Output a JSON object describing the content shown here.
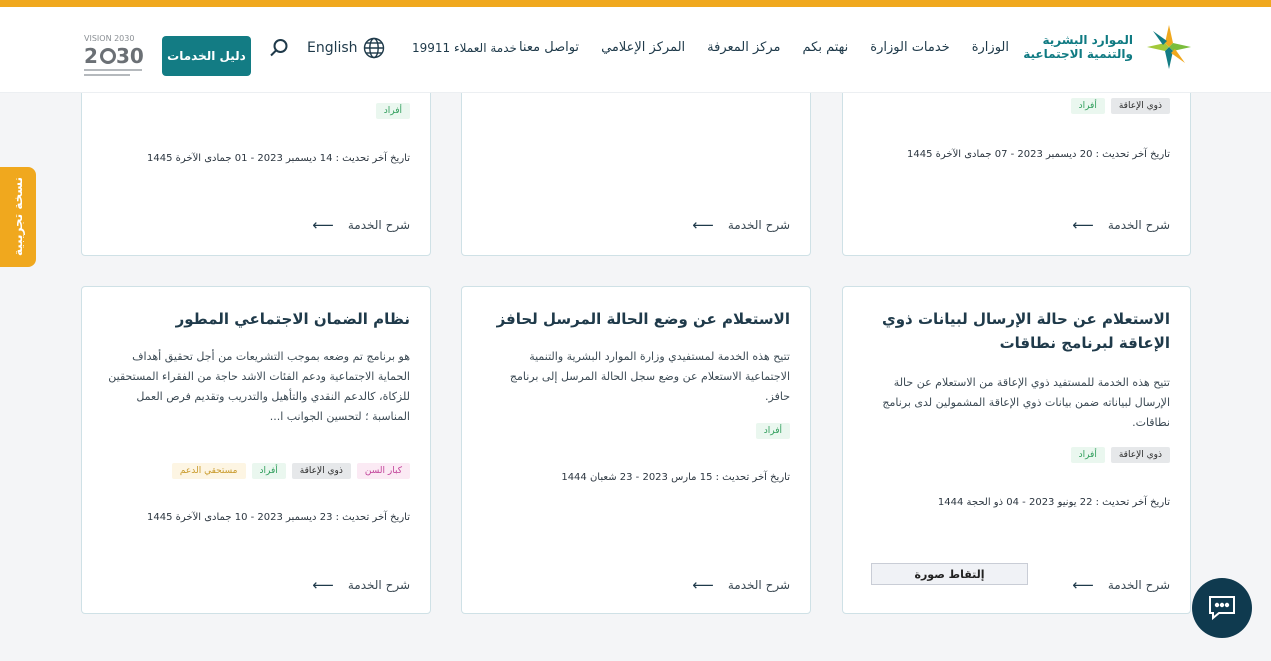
{
  "header": {
    "logo_line1": "الموارد البشرية",
    "logo_line2": "والتنمية الاجتماعية",
    "nav": [
      "الوزارة",
      "خدمات الوزارة",
      "نهتم بكم",
      "مركز المعرفة",
      "المركز الإعلامي",
      "تواصل معنا"
    ],
    "hotline": "خدمة العملاء 19911",
    "language": "English",
    "services_guide": "دليل الخدمات",
    "vision_label": "VISION 2030"
  },
  "side_tab": "نسخة تجريبية",
  "top_row": [
    {
      "tags": [
        "ذوي الإعاقة",
        "أفراد"
      ],
      "date": "تاريخ آخر تحديث : 20 ديسمبر 2023 - 07 جمادى الآخرة 1445",
      "explain": "شرح الخدمة"
    },
    {
      "explain": "شرح الخدمة"
    },
    {
      "tags": [
        "أفراد"
      ],
      "date": "تاريخ آخر تحديث : 14 ديسمبر 2023 - 01 جمادى الآخرة 1445",
      "explain": "شرح الخدمة"
    }
  ],
  "cards": [
    {
      "title": "الاستعلام عن حالة الإرسال لبيانات ذوي الإعاقة لبرنامج نطاقات",
      "description": "تتيح هذه الخدمة للمستفيد ذوي الإعاقة من الاستعلام عن حالة الإرسال لبياناته ضمن بيانات ذوي الإعاقة المشمولين لدى برنامج نطاقات.",
      "tags": [
        "ذوي الإعاقة",
        "أفراد"
      ],
      "date": "تاريخ آخر تحديث : 22 يونيو 2023 - 04 ذو الحجة 1444",
      "explain": "شرح الخدمة",
      "screenshot_button": "إلتقاط صورة"
    },
    {
      "title": "الاستعلام عن وضع الحالة المرسل لحافز",
      "description": "تتيح هذه الخدمة لمستفيدي وزارة الموارد البشرية والتنمية الاجتماعية الاستعلام عن وضع سجل الحالة المرسل إلى برنامج حافز.",
      "tags": [
        "أفراد"
      ],
      "date": "تاريخ آخر تحديث : 15 مارس 2023 - 23 شعبان 1444",
      "explain": "شرح الخدمة"
    },
    {
      "title": "نظام الضمان الاجتماعي المطور",
      "description": "هو برنامج تم وضعه بموجب التشريعات من أجل تحقيق أهداف الحماية الاجتماعية ودعم الفئات الاشد حاجة من الفقراء المستحقين للزكاة، كالدعم النقدي والتأهيل والتدريب وتقديم فرص العمل المناسبة ؛ لتحسين الجوانب ا...",
      "tags": [
        "كبار السن",
        "ذوي الإعاقة",
        "أفراد",
        "مستحقي الدعم"
      ],
      "date": "تاريخ آخر تحديث : 23 ديسمبر 2023 - 10 جمادى الآخرة 1445",
      "explain": "شرح الخدمة"
    }
  ],
  "colors": {
    "brand_teal": "#137c84",
    "accent_orange": "#f0a81e",
    "chat_navy": "#0f3a4f"
  }
}
